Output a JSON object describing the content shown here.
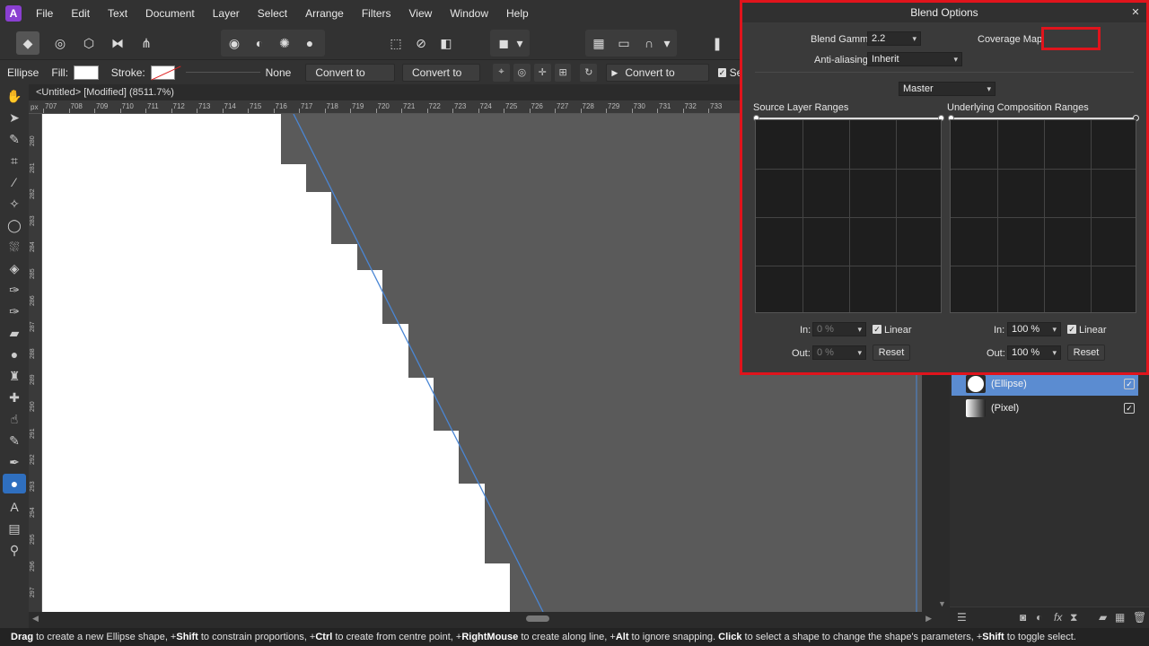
{
  "menu": {
    "logo_glyph": "A",
    "items": [
      "File",
      "Edit",
      "Text",
      "Document",
      "Layer",
      "Select",
      "Arrange",
      "Filters",
      "View",
      "Window",
      "Help"
    ]
  },
  "context_bar": {
    "shape_name": "Ellipse",
    "fill_label": "Fill:",
    "stroke_label": "Stroke:",
    "stroke_value": "None",
    "convert_donut": "Convert to Donut",
    "convert_pie": "Convert to Pie",
    "convert_curves": "Convert to Curves",
    "selection_truncated": "Sel"
  },
  "document": {
    "title": "<Untitled> [Modified] (8511.7%)",
    "ruler_unit": "px",
    "ruler_top_ticks": [
      "707",
      "708",
      "709",
      "710",
      "711",
      "712",
      "713",
      "714",
      "715",
      "716",
      "717",
      "718",
      "719",
      "720",
      "721",
      "722",
      "723",
      "724",
      "725",
      "726",
      "727",
      "728",
      "729",
      "730",
      "731",
      "732",
      "733"
    ],
    "ruler_left_ticks": [
      "280",
      "281",
      "282",
      "283",
      "284",
      "285",
      "286",
      "287",
      "288",
      "289",
      "290",
      "291",
      "292",
      "293",
      "294",
      "295",
      "296",
      "297"
    ]
  },
  "blend_options": {
    "title": "Blend Options",
    "close_glyph": "✕",
    "blend_gamma_label": "Blend Gamma:",
    "blend_gamma_value": "2.2",
    "coverage_map_label": "Coverage Map:",
    "anti_aliasing_label": "Anti-aliasing:",
    "anti_aliasing_value": "Inherit",
    "channel_value": "Master",
    "source_ranges_label": "Source Layer Ranges",
    "underlying_ranges_label": "Underlying Composition Ranges",
    "source": {
      "in_label": "In:",
      "in_value": "0 %",
      "out_label": "Out:",
      "out_value": "0 %",
      "linear_label": "Linear",
      "linear_checked": true,
      "reset_label": "Reset"
    },
    "underlying": {
      "in_label": "In:",
      "in_value": "100 %",
      "out_label": "Out:",
      "out_value": "100 %",
      "linear_label": "Linear",
      "linear_checked": true,
      "reset_label": "Reset"
    }
  },
  "layers": [
    {
      "name": "(Ellipse)",
      "selected": true,
      "visible": true
    },
    {
      "name": "(Pixel)",
      "selected": false,
      "visible": true
    }
  ],
  "status_bar": {
    "segments": [
      {
        "bold": "Drag",
        "text": " to create a new Ellipse shape, +"
      },
      {
        "bold": "Shift",
        "text": " to constrain proportions, +"
      },
      {
        "bold": "Ctrl",
        "text": " to create from centre point, +"
      },
      {
        "bold": "RightMouse",
        "text": " to create along line, +"
      },
      {
        "bold": "Alt",
        "text": " to ignore snapping. "
      },
      {
        "bold": "Click",
        "text": " to select a shape to change the shape's parameters, +"
      },
      {
        "bold": "Shift",
        "text": " to toggle select."
      }
    ]
  },
  "colors": {
    "accent": "#5b8cd1",
    "highlight_border": "#e0141c",
    "canvas_bg": "#5a5a5a",
    "shape_fill": "#ffffff",
    "path_line": "#4a86d4"
  }
}
